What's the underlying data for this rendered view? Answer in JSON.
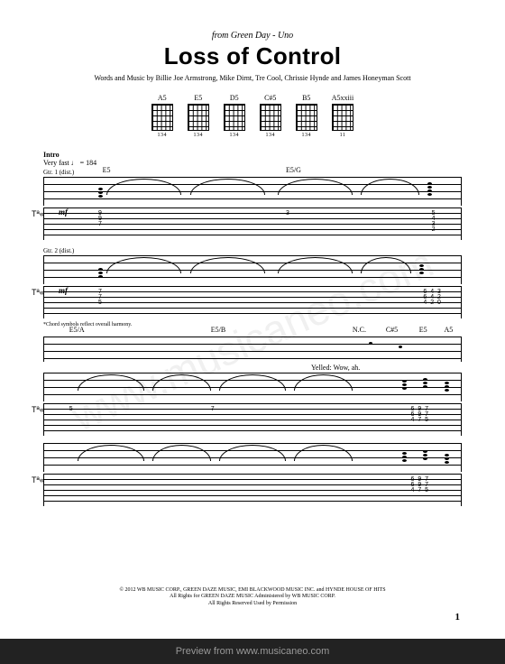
{
  "source": "from Green Day - Uno",
  "title": "Loss of Control",
  "credits": "Words and Music by Billie Joe Armstrong, Mike Dirnt, Tre Cool, Chrissie Hynde and James Honeyman Scott",
  "chord_names": [
    "A5",
    "E5",
    "D5",
    "C#5",
    "B5",
    "A5xxiii"
  ],
  "chord_fingers": [
    "134",
    "134",
    "134",
    "134",
    "134",
    "11"
  ],
  "intro_label": "Intro",
  "tempo": "Very fast ♩ = 184",
  "gtr1_label": "Gtr. 1 (dist.)",
  "gtr2_label": "Gtr. 2 (dist.)",
  "dynamic": "mf",
  "sys1_chords": [
    {
      "p": 14,
      "t": "E5"
    },
    {
      "p": 58,
      "t": "E5/G"
    }
  ],
  "sys2_chords": [
    {
      "p": 6,
      "t": "E5/A"
    },
    {
      "p": 40,
      "t": "E5/B"
    },
    {
      "p": 74,
      "t": "N.C."
    },
    {
      "p": 82,
      "t": "C#5"
    },
    {
      "p": 90,
      "t": "E5"
    },
    {
      "p": 96,
      "t": "A5"
    }
  ],
  "lyric_label": "Yelled:",
  "lyric_text": "Wow,        ah.",
  "footnote": "*Chord symbols reflect overall harmony.",
  "tab_nums_1": [
    {
      "p": 13,
      "t": "9\n9\n7"
    },
    {
      "p": 58,
      "t": "3"
    },
    {
      "p": 93,
      "t": "5\n4\n3\n2"
    }
  ],
  "tab_nums_2": [
    {
      "p": 13,
      "t": "7\n7\n5"
    },
    {
      "p": 91,
      "t": "6  4  3\n6  4  2\n4  2  0"
    }
  ],
  "tab_nums_3": [
    {
      "p": 6,
      "t": "5"
    },
    {
      "p": 40,
      "t": "7"
    },
    {
      "p": 88,
      "t": "6  9  7\n6  9  7\n4  7  5"
    }
  ],
  "tab_nums_4": [
    {
      "p": 88,
      "t": "6  9  7\n6  9  7\n4  7  5"
    }
  ],
  "copyright": "© 2012 WB MUSIC CORP., GREEN DAZE MUSIC, EMI BLACKWOOD MUSIC INC. and HYNDE HOUSE OF HITS\nAll Rights for GREEN DAZE MUSIC Administered by WB MUSIC CORP.\nAll Rights Reserved   Used by Permission",
  "page_number": "1",
  "watermark": "www.musicaneo.com",
  "preview_text": "Preview from www.musicaneo.com"
}
